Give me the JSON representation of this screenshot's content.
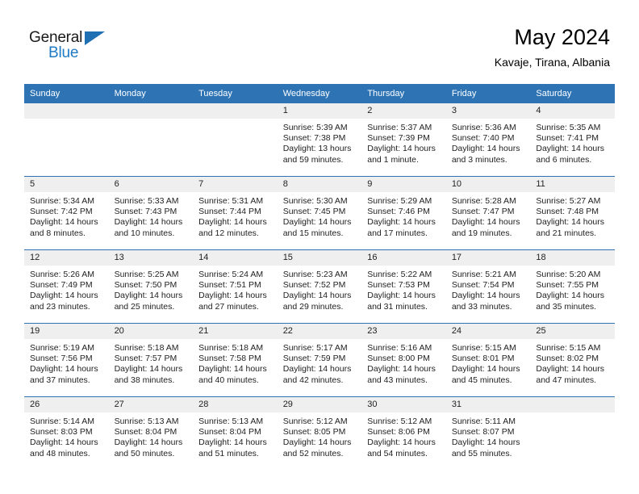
{
  "brand": {
    "name_top": "General",
    "name_bottom": "Blue",
    "triangle_icon": "triangle-logo-icon",
    "color_blue": "#1f7ac4",
    "color_dark": "#1a1a1a"
  },
  "header": {
    "title": "May 2024",
    "location": "Kavaje, Tirana, Albania"
  },
  "theme": {
    "header_blue": "#2e74b5",
    "date_band": "#efefef",
    "text": "#222222"
  },
  "weekday_headers": [
    "Sunday",
    "Monday",
    "Tuesday",
    "Wednesday",
    "Thursday",
    "Friday",
    "Saturday"
  ],
  "weeks": [
    [
      {
        "day": "",
        "empty": true,
        "sunrise": "",
        "sunset": "",
        "daylight1": "",
        "daylight2": ""
      },
      {
        "day": "",
        "empty": true,
        "sunrise": "",
        "sunset": "",
        "daylight1": "",
        "daylight2": ""
      },
      {
        "day": "",
        "empty": true,
        "sunrise": "",
        "sunset": "",
        "daylight1": "",
        "daylight2": ""
      },
      {
        "day": "1",
        "empty": false,
        "sunrise": "Sunrise: 5:39 AM",
        "sunset": "Sunset: 7:38 PM",
        "daylight1": "Daylight: 13 hours",
        "daylight2": "and 59 minutes."
      },
      {
        "day": "2",
        "empty": false,
        "sunrise": "Sunrise: 5:37 AM",
        "sunset": "Sunset: 7:39 PM",
        "daylight1": "Daylight: 14 hours",
        "daylight2": "and 1 minute."
      },
      {
        "day": "3",
        "empty": false,
        "sunrise": "Sunrise: 5:36 AM",
        "sunset": "Sunset: 7:40 PM",
        "daylight1": "Daylight: 14 hours",
        "daylight2": "and 3 minutes."
      },
      {
        "day": "4",
        "empty": false,
        "sunrise": "Sunrise: 5:35 AM",
        "sunset": "Sunset: 7:41 PM",
        "daylight1": "Daylight: 14 hours",
        "daylight2": "and 6 minutes."
      }
    ],
    [
      {
        "day": "5",
        "empty": false,
        "sunrise": "Sunrise: 5:34 AM",
        "sunset": "Sunset: 7:42 PM",
        "daylight1": "Daylight: 14 hours",
        "daylight2": "and 8 minutes."
      },
      {
        "day": "6",
        "empty": false,
        "sunrise": "Sunrise: 5:33 AM",
        "sunset": "Sunset: 7:43 PM",
        "daylight1": "Daylight: 14 hours",
        "daylight2": "and 10 minutes."
      },
      {
        "day": "7",
        "empty": false,
        "sunrise": "Sunrise: 5:31 AM",
        "sunset": "Sunset: 7:44 PM",
        "daylight1": "Daylight: 14 hours",
        "daylight2": "and 12 minutes."
      },
      {
        "day": "8",
        "empty": false,
        "sunrise": "Sunrise: 5:30 AM",
        "sunset": "Sunset: 7:45 PM",
        "daylight1": "Daylight: 14 hours",
        "daylight2": "and 15 minutes."
      },
      {
        "day": "9",
        "empty": false,
        "sunrise": "Sunrise: 5:29 AM",
        "sunset": "Sunset: 7:46 PM",
        "daylight1": "Daylight: 14 hours",
        "daylight2": "and 17 minutes."
      },
      {
        "day": "10",
        "empty": false,
        "sunrise": "Sunrise: 5:28 AM",
        "sunset": "Sunset: 7:47 PM",
        "daylight1": "Daylight: 14 hours",
        "daylight2": "and 19 minutes."
      },
      {
        "day": "11",
        "empty": false,
        "sunrise": "Sunrise: 5:27 AM",
        "sunset": "Sunset: 7:48 PM",
        "daylight1": "Daylight: 14 hours",
        "daylight2": "and 21 minutes."
      }
    ],
    [
      {
        "day": "12",
        "empty": false,
        "sunrise": "Sunrise: 5:26 AM",
        "sunset": "Sunset: 7:49 PM",
        "daylight1": "Daylight: 14 hours",
        "daylight2": "and 23 minutes."
      },
      {
        "day": "13",
        "empty": false,
        "sunrise": "Sunrise: 5:25 AM",
        "sunset": "Sunset: 7:50 PM",
        "daylight1": "Daylight: 14 hours",
        "daylight2": "and 25 minutes."
      },
      {
        "day": "14",
        "empty": false,
        "sunrise": "Sunrise: 5:24 AM",
        "sunset": "Sunset: 7:51 PM",
        "daylight1": "Daylight: 14 hours",
        "daylight2": "and 27 minutes."
      },
      {
        "day": "15",
        "empty": false,
        "sunrise": "Sunrise: 5:23 AM",
        "sunset": "Sunset: 7:52 PM",
        "daylight1": "Daylight: 14 hours",
        "daylight2": "and 29 minutes."
      },
      {
        "day": "16",
        "empty": false,
        "sunrise": "Sunrise: 5:22 AM",
        "sunset": "Sunset: 7:53 PM",
        "daylight1": "Daylight: 14 hours",
        "daylight2": "and 31 minutes."
      },
      {
        "day": "17",
        "empty": false,
        "sunrise": "Sunrise: 5:21 AM",
        "sunset": "Sunset: 7:54 PM",
        "daylight1": "Daylight: 14 hours",
        "daylight2": "and 33 minutes."
      },
      {
        "day": "18",
        "empty": false,
        "sunrise": "Sunrise: 5:20 AM",
        "sunset": "Sunset: 7:55 PM",
        "daylight1": "Daylight: 14 hours",
        "daylight2": "and 35 minutes."
      }
    ],
    [
      {
        "day": "19",
        "empty": false,
        "sunrise": "Sunrise: 5:19 AM",
        "sunset": "Sunset: 7:56 PM",
        "daylight1": "Daylight: 14 hours",
        "daylight2": "and 37 minutes."
      },
      {
        "day": "20",
        "empty": false,
        "sunrise": "Sunrise: 5:18 AM",
        "sunset": "Sunset: 7:57 PM",
        "daylight1": "Daylight: 14 hours",
        "daylight2": "and 38 minutes."
      },
      {
        "day": "21",
        "empty": false,
        "sunrise": "Sunrise: 5:18 AM",
        "sunset": "Sunset: 7:58 PM",
        "daylight1": "Daylight: 14 hours",
        "daylight2": "and 40 minutes."
      },
      {
        "day": "22",
        "empty": false,
        "sunrise": "Sunrise: 5:17 AM",
        "sunset": "Sunset: 7:59 PM",
        "daylight1": "Daylight: 14 hours",
        "daylight2": "and 42 minutes."
      },
      {
        "day": "23",
        "empty": false,
        "sunrise": "Sunrise: 5:16 AM",
        "sunset": "Sunset: 8:00 PM",
        "daylight1": "Daylight: 14 hours",
        "daylight2": "and 43 minutes."
      },
      {
        "day": "24",
        "empty": false,
        "sunrise": "Sunrise: 5:15 AM",
        "sunset": "Sunset: 8:01 PM",
        "daylight1": "Daylight: 14 hours",
        "daylight2": "and 45 minutes."
      },
      {
        "day": "25",
        "empty": false,
        "sunrise": "Sunrise: 5:15 AM",
        "sunset": "Sunset: 8:02 PM",
        "daylight1": "Daylight: 14 hours",
        "daylight2": "and 47 minutes."
      }
    ],
    [
      {
        "day": "26",
        "empty": false,
        "sunrise": "Sunrise: 5:14 AM",
        "sunset": "Sunset: 8:03 PM",
        "daylight1": "Daylight: 14 hours",
        "daylight2": "and 48 minutes."
      },
      {
        "day": "27",
        "empty": false,
        "sunrise": "Sunrise: 5:13 AM",
        "sunset": "Sunset: 8:04 PM",
        "daylight1": "Daylight: 14 hours",
        "daylight2": "and 50 minutes."
      },
      {
        "day": "28",
        "empty": false,
        "sunrise": "Sunrise: 5:13 AM",
        "sunset": "Sunset: 8:04 PM",
        "daylight1": "Daylight: 14 hours",
        "daylight2": "and 51 minutes."
      },
      {
        "day": "29",
        "empty": false,
        "sunrise": "Sunrise: 5:12 AM",
        "sunset": "Sunset: 8:05 PM",
        "daylight1": "Daylight: 14 hours",
        "daylight2": "and 52 minutes."
      },
      {
        "day": "30",
        "empty": false,
        "sunrise": "Sunrise: 5:12 AM",
        "sunset": "Sunset: 8:06 PM",
        "daylight1": "Daylight: 14 hours",
        "daylight2": "and 54 minutes."
      },
      {
        "day": "31",
        "empty": false,
        "sunrise": "Sunrise: 5:11 AM",
        "sunset": "Sunset: 8:07 PM",
        "daylight1": "Daylight: 14 hours",
        "daylight2": "and 55 minutes."
      },
      {
        "day": "",
        "empty": true,
        "sunrise": "",
        "sunset": "",
        "daylight1": "",
        "daylight2": ""
      }
    ]
  ]
}
